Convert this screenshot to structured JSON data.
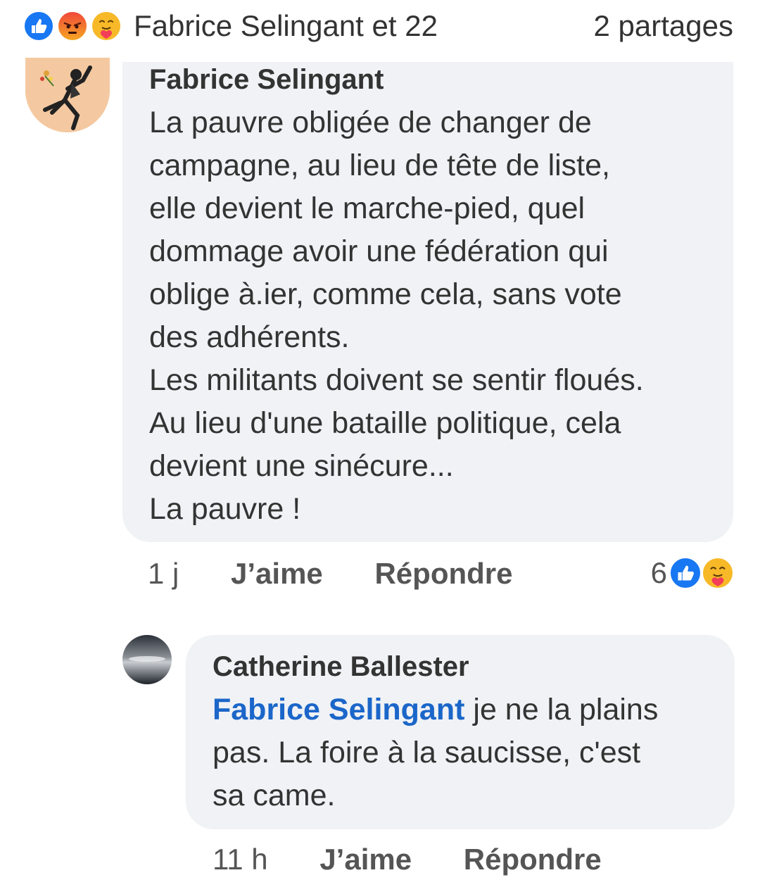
{
  "reactions_bar": {
    "names": "Fabrice Selingant et 22",
    "shares": "2 partages",
    "icons": [
      "like-icon",
      "angry-icon",
      "care-icon"
    ],
    "colors": {
      "like": "#1877f2",
      "angry": "#f0483b",
      "care": "#f7b928"
    }
  },
  "comments": [
    {
      "author": "Fabrice Selingant",
      "text": "La pauvre obligée de changer de\ncampagne, au lieu de tête de liste,\nelle devient le marche-pied, quel\ndommage avoir une fédération qui\noblige à.ier, comme cela, sans vote\ndes adhérents.\nLes militants doivent se sentir floués.\nAu lieu d'une bataille politique, cela\ndevient une sinécure...\nLa pauvre !",
      "time": "1 j",
      "like_label": "J’aime",
      "reply_label": "Répondre",
      "reaction_count": "6",
      "reaction_icons": [
        "like-icon",
        "care-icon"
      ]
    },
    {
      "author": "Catherine Ballester",
      "mention": "Fabrice Selingant",
      "text": " je ne la plains\npas. La foire à la saucisse, c'est\nsa came.",
      "time": "11 h",
      "like_label": "J’aime",
      "reply_label": "Répondre"
    }
  ],
  "theme": {
    "bubble_bg": "#f0f2f5",
    "mention_color": "#1b66c9",
    "text_color": "#333333"
  }
}
